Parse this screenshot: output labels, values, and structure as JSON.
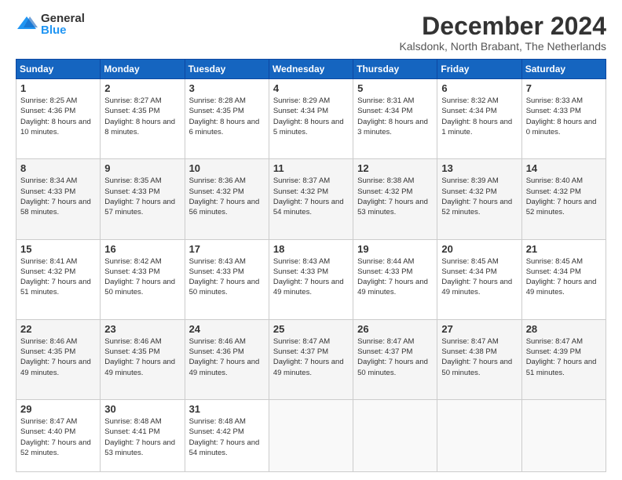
{
  "logo": {
    "general": "General",
    "blue": "Blue"
  },
  "title": {
    "month": "December 2024",
    "location": "Kalsdonk, North Brabant, The Netherlands"
  },
  "headers": [
    "Sunday",
    "Monday",
    "Tuesday",
    "Wednesday",
    "Thursday",
    "Friday",
    "Saturday"
  ],
  "weeks": [
    [
      {
        "day": "1",
        "sunrise": "8:25 AM",
        "sunset": "4:36 PM",
        "daylight": "8 hours and 10 minutes."
      },
      {
        "day": "2",
        "sunrise": "8:27 AM",
        "sunset": "4:35 PM",
        "daylight": "8 hours and 8 minutes."
      },
      {
        "day": "3",
        "sunrise": "8:28 AM",
        "sunset": "4:35 PM",
        "daylight": "8 hours and 6 minutes."
      },
      {
        "day": "4",
        "sunrise": "8:29 AM",
        "sunset": "4:34 PM",
        "daylight": "8 hours and 5 minutes."
      },
      {
        "day": "5",
        "sunrise": "8:31 AM",
        "sunset": "4:34 PM",
        "daylight": "8 hours and 3 minutes."
      },
      {
        "day": "6",
        "sunrise": "8:32 AM",
        "sunset": "4:34 PM",
        "daylight": "8 hours and 1 minute."
      },
      {
        "day": "7",
        "sunrise": "8:33 AM",
        "sunset": "4:33 PM",
        "daylight": "8 hours and 0 minutes."
      }
    ],
    [
      {
        "day": "8",
        "sunrise": "8:34 AM",
        "sunset": "4:33 PM",
        "daylight": "7 hours and 58 minutes."
      },
      {
        "day": "9",
        "sunrise": "8:35 AM",
        "sunset": "4:33 PM",
        "daylight": "7 hours and 57 minutes."
      },
      {
        "day": "10",
        "sunrise": "8:36 AM",
        "sunset": "4:32 PM",
        "daylight": "7 hours and 56 minutes."
      },
      {
        "day": "11",
        "sunrise": "8:37 AM",
        "sunset": "4:32 PM",
        "daylight": "7 hours and 54 minutes."
      },
      {
        "day": "12",
        "sunrise": "8:38 AM",
        "sunset": "4:32 PM",
        "daylight": "7 hours and 53 minutes."
      },
      {
        "day": "13",
        "sunrise": "8:39 AM",
        "sunset": "4:32 PM",
        "daylight": "7 hours and 52 minutes."
      },
      {
        "day": "14",
        "sunrise": "8:40 AM",
        "sunset": "4:32 PM",
        "daylight": "7 hours and 52 minutes."
      }
    ],
    [
      {
        "day": "15",
        "sunrise": "8:41 AM",
        "sunset": "4:32 PM",
        "daylight": "7 hours and 51 minutes."
      },
      {
        "day": "16",
        "sunrise": "8:42 AM",
        "sunset": "4:33 PM",
        "daylight": "7 hours and 50 minutes."
      },
      {
        "day": "17",
        "sunrise": "8:43 AM",
        "sunset": "4:33 PM",
        "daylight": "7 hours and 50 minutes."
      },
      {
        "day": "18",
        "sunrise": "8:43 AM",
        "sunset": "4:33 PM",
        "daylight": "7 hours and 49 minutes."
      },
      {
        "day": "19",
        "sunrise": "8:44 AM",
        "sunset": "4:33 PM",
        "daylight": "7 hours and 49 minutes."
      },
      {
        "day": "20",
        "sunrise": "8:45 AM",
        "sunset": "4:34 PM",
        "daylight": "7 hours and 49 minutes."
      },
      {
        "day": "21",
        "sunrise": "8:45 AM",
        "sunset": "4:34 PM",
        "daylight": "7 hours and 49 minutes."
      }
    ],
    [
      {
        "day": "22",
        "sunrise": "8:46 AM",
        "sunset": "4:35 PM",
        "daylight": "7 hours and 49 minutes."
      },
      {
        "day": "23",
        "sunrise": "8:46 AM",
        "sunset": "4:35 PM",
        "daylight": "7 hours and 49 minutes."
      },
      {
        "day": "24",
        "sunrise": "8:46 AM",
        "sunset": "4:36 PM",
        "daylight": "7 hours and 49 minutes."
      },
      {
        "day": "25",
        "sunrise": "8:47 AM",
        "sunset": "4:37 PM",
        "daylight": "7 hours and 49 minutes."
      },
      {
        "day": "26",
        "sunrise": "8:47 AM",
        "sunset": "4:37 PM",
        "daylight": "7 hours and 50 minutes."
      },
      {
        "day": "27",
        "sunrise": "8:47 AM",
        "sunset": "4:38 PM",
        "daylight": "7 hours and 50 minutes."
      },
      {
        "day": "28",
        "sunrise": "8:47 AM",
        "sunset": "4:39 PM",
        "daylight": "7 hours and 51 minutes."
      }
    ],
    [
      {
        "day": "29",
        "sunrise": "8:47 AM",
        "sunset": "4:40 PM",
        "daylight": "7 hours and 52 minutes."
      },
      {
        "day": "30",
        "sunrise": "8:48 AM",
        "sunset": "4:41 PM",
        "daylight": "7 hours and 53 minutes."
      },
      {
        "day": "31",
        "sunrise": "8:48 AM",
        "sunset": "4:42 PM",
        "daylight": "7 hours and 54 minutes."
      },
      null,
      null,
      null,
      null
    ]
  ],
  "labels": {
    "sunrise": "Sunrise:",
    "sunset": "Sunset:",
    "daylight": "Daylight:"
  }
}
